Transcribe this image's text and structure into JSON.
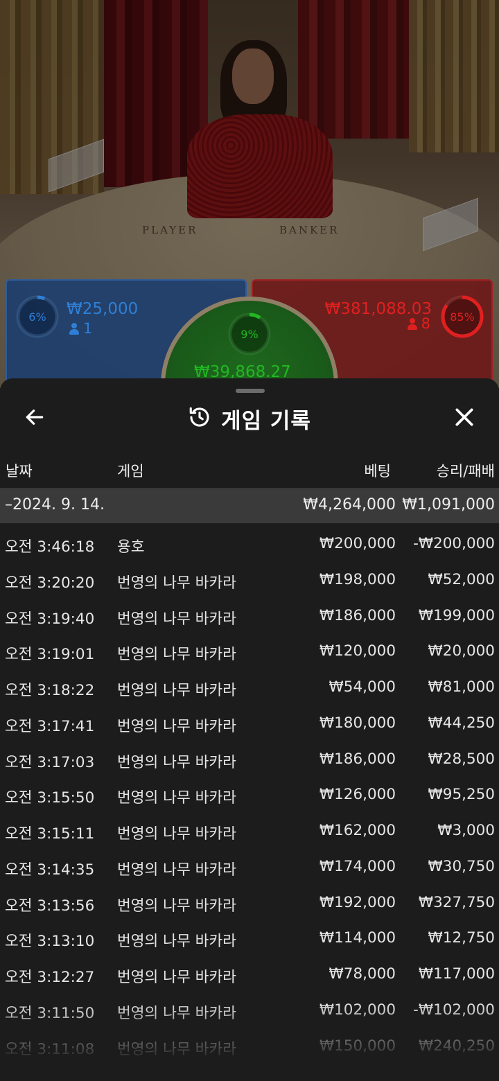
{
  "video": {
    "table_labels": {
      "player": "PLAYER",
      "banker": "BANKER"
    }
  },
  "spots": {
    "player": {
      "percent": "6%",
      "percent_value": 0.06,
      "amount": "₩25,000",
      "count": "1",
      "color": "#2f7fd6"
    },
    "banker": {
      "percent": "85%",
      "percent_value": 0.85,
      "amount": "₩381,088.03",
      "count": "8",
      "color": "#e02020"
    },
    "tie": {
      "percent": "9%",
      "percent_value": 0.09,
      "amount": "₩39,868.27",
      "color": "#22b822"
    }
  },
  "sheet": {
    "title": "게임 기록",
    "icons": {
      "back": "arrow-left-icon",
      "history": "history-icon",
      "close": "close-icon"
    },
    "columns": {
      "date": "날짜",
      "game": "게임",
      "bet": "베팅",
      "result": "승리/패배"
    },
    "date_row": {
      "date": "–2024. 9. 14.",
      "bet_total": "₩4,264,000",
      "result_total": "₩1,091,000"
    },
    "rows": [
      {
        "time": "오전 3:46:18",
        "game": "용호",
        "bet": "₩200,000",
        "result": "-₩200,000"
      },
      {
        "time": "오전 3:20:20",
        "game": "번영의 나무 바카라",
        "bet": "₩198,000",
        "result": "₩52,000"
      },
      {
        "time": "오전 3:19:40",
        "game": "번영의 나무 바카라",
        "bet": "₩186,000",
        "result": "₩199,000"
      },
      {
        "time": "오전 3:19:01",
        "game": "번영의 나무 바카라",
        "bet": "₩120,000",
        "result": "₩20,000"
      },
      {
        "time": "오전 3:18:22",
        "game": "번영의 나무 바카라",
        "bet": "₩54,000",
        "result": "₩81,000"
      },
      {
        "time": "오전 3:17:41",
        "game": "번영의 나무 바카라",
        "bet": "₩180,000",
        "result": "₩44,250"
      },
      {
        "time": "오전 3:17:03",
        "game": "번영의 나무 바카라",
        "bet": "₩186,000",
        "result": "₩28,500"
      },
      {
        "time": "오전 3:15:50",
        "game": "번영의 나무 바카라",
        "bet": "₩126,000",
        "result": "₩95,250"
      },
      {
        "time": "오전 3:15:11",
        "game": "번영의 나무 바카라",
        "bet": "₩162,000",
        "result": "₩3,000"
      },
      {
        "time": "오전 3:14:35",
        "game": "번영의 나무 바카라",
        "bet": "₩174,000",
        "result": "₩30,750"
      },
      {
        "time": "오전 3:13:56",
        "game": "번영의 나무 바카라",
        "bet": "₩192,000",
        "result": "₩327,750"
      },
      {
        "time": "오전 3:13:10",
        "game": "번영의 나무 바카라",
        "bet": "₩114,000",
        "result": "₩12,750"
      },
      {
        "time": "오전 3:12:27",
        "game": "번영의 나무 바카라",
        "bet": "₩78,000",
        "result": "₩117,000"
      },
      {
        "time": "오전 3:11:50",
        "game": "번영의 나무 바카라",
        "bet": "₩102,000",
        "result": "-₩102,000"
      },
      {
        "time": "오전 3:11:08",
        "game": "번영의 나무 바카라",
        "bet": "₩150,000",
        "result": "₩240,250"
      }
    ]
  }
}
